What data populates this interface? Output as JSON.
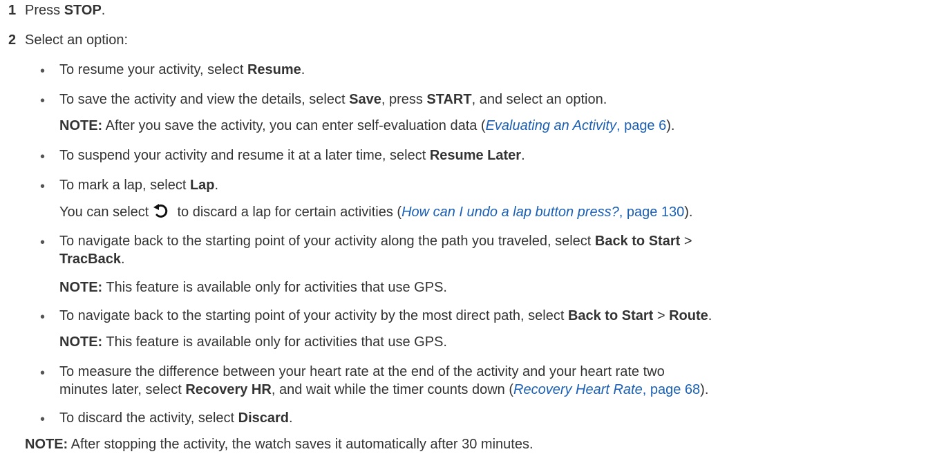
{
  "steps": [
    {
      "num": "1",
      "pre": "Press ",
      "bold": "STOP",
      "post": "."
    },
    {
      "num": "2",
      "text": "Select an option:"
    }
  ],
  "bullet_glyph": "•",
  "items": {
    "resume": {
      "pre": "To resume your activity, select ",
      "b1": "Resume",
      "post": "."
    },
    "save": {
      "pre": "To save the activity and view the details, select ",
      "b1": "Save",
      "mid": ", press ",
      "b2": "START",
      "post": ", and select an option."
    },
    "save_note": {
      "label": "NOTE:",
      "pre": " After you save the activity, you can enter self-evaluation data (",
      "link_title": "Evaluating an Activity",
      "link_page": ", page 6",
      "post": ")."
    },
    "resume_later": {
      "pre": "To suspend your activity and resume it at a later time, select ",
      "b1": "Resume Later",
      "post": "."
    },
    "lap": {
      "pre": "To mark a lap, select ",
      "b1": "Lap",
      "post": "."
    },
    "lap_note": {
      "pre": "You can select ",
      "post": " to discard a lap for certain activities (",
      "link_title": "How can I undo a lap button press?",
      "link_page": ", page 130",
      "end": ")."
    },
    "tracback": {
      "pre": "To navigate back to the starting point of your activity along the path you traveled, select ",
      "b1": "Back to Start",
      "post": " >",
      "b2": "TracBack",
      "end": "."
    },
    "tracback_note": {
      "label": "NOTE:",
      "text": " This feature is available only for activities that use GPS."
    },
    "route": {
      "pre": "To navigate back to the starting point of your activity by the most direct path, select ",
      "b1": "Back to Start",
      "mid": " > ",
      "b2": "Route",
      "post": "."
    },
    "route_note": {
      "label": "NOTE:",
      "text": " This feature is available only for activities that use GPS."
    },
    "recovery": {
      "line1": "To measure the difference between your heart rate at the end of the activity and your heart rate two",
      "pre": "minutes later, select ",
      "b1": "Recovery HR",
      "post": ", and wait while the timer counts down (",
      "link_title": "Recovery Heart Rate",
      "link_page": ", page 68",
      "end": ")."
    },
    "discard": {
      "pre": "To discard the activity, select ",
      "b1": "Discard",
      "post": "."
    }
  },
  "final_note": {
    "label": "NOTE:",
    "text": " After stopping the activity, the watch saves it automatically after 30 minutes."
  },
  "colors": {
    "text": "#333333",
    "link": "#1a5fb4"
  }
}
